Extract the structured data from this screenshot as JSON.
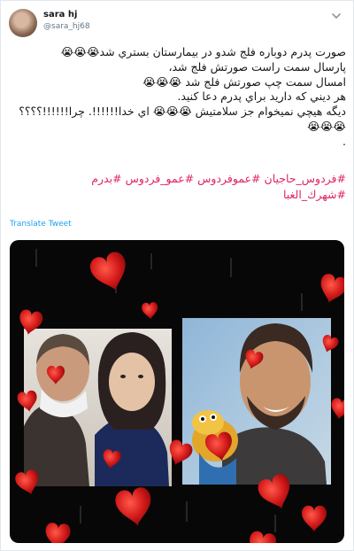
{
  "tweet": {
    "author_name": "sara hj",
    "author_handle": "@sara_hj68",
    "lines": [
      "صورت پدرم دوباره فلج شدو در بيمارستان بستري شد😭😭😭",
      "پارسال سمت راست صورتش فلج شد،",
      "امسال سمت چپ صورتش فلج شد 😭😭😭",
      "هر ديني كه داريد براي پدرم دعا كنيد.",
      "ديگه هيچي نميخوام جز سلامتيش 😭😭😭 اي خدا!!!!!!. چرا!!!!!!؟؟؟؟",
      "😭😭😭",
      "."
    ],
    "hashtags_line1": [
      "#فردوس_حاجيان",
      "#عموفردوس",
      "#عمو_فردوس",
      "#بدرم"
    ],
    "hashtags_line2": [
      "#شهرك_الغبا"
    ],
    "translate_label": "Translate Tweet"
  },
  "icons": {
    "caret": "chevron-down-icon",
    "avatar": "avatar",
    "media": "image-with-hearts"
  },
  "colors": {
    "hashtag": "#e0245e",
    "link": "#1da1f2",
    "muted": "#657786",
    "heart": "#d41a1a"
  }
}
